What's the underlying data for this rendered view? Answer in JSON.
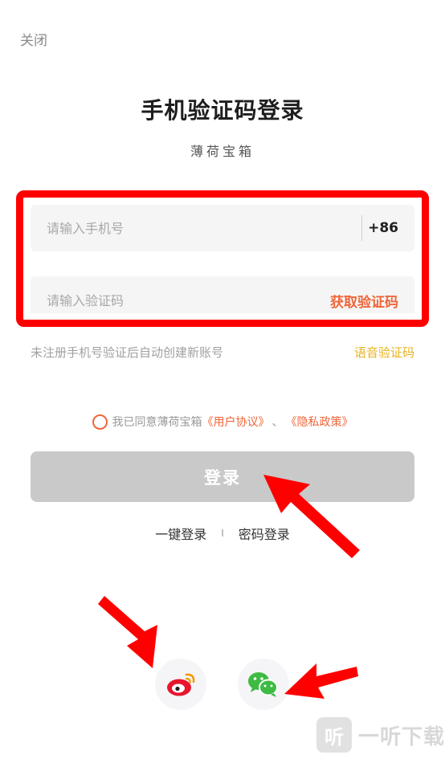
{
  "header": {
    "close_label": "关闭"
  },
  "title": "手机验证码登录",
  "subtitle": "薄荷宝箱",
  "phone_field": {
    "placeholder": "请输入手机号",
    "value": "",
    "country_code": "+86"
  },
  "code_field": {
    "placeholder": "请输入验证码",
    "value": "",
    "get_code_label": "获取验证码"
  },
  "hint": "未注册手机号验证后自动创建新账号",
  "voice_code_label": "语音验证码",
  "agreement": {
    "prefix": "我已同意薄荷宝箱",
    "user_agreement": "《用户协议》",
    "separator": "、",
    "privacy_policy": "《隐私政策》",
    "checked": false
  },
  "login_button_label": "登录",
  "alt_login": {
    "one_click": "一键登录",
    "separator": "I",
    "password": "密码登录"
  },
  "social": [
    "weibo-icon",
    "wechat-icon"
  ],
  "watermark": {
    "icon_glyph": "听",
    "text": "一听下载"
  },
  "colors": {
    "accent": "#f0663a",
    "voice": "#e7b321",
    "annotation_red": "#ff0000",
    "button_disabled": "#c9c9c9",
    "weibo": "#e6162d",
    "wechat": "#3dbb43"
  }
}
